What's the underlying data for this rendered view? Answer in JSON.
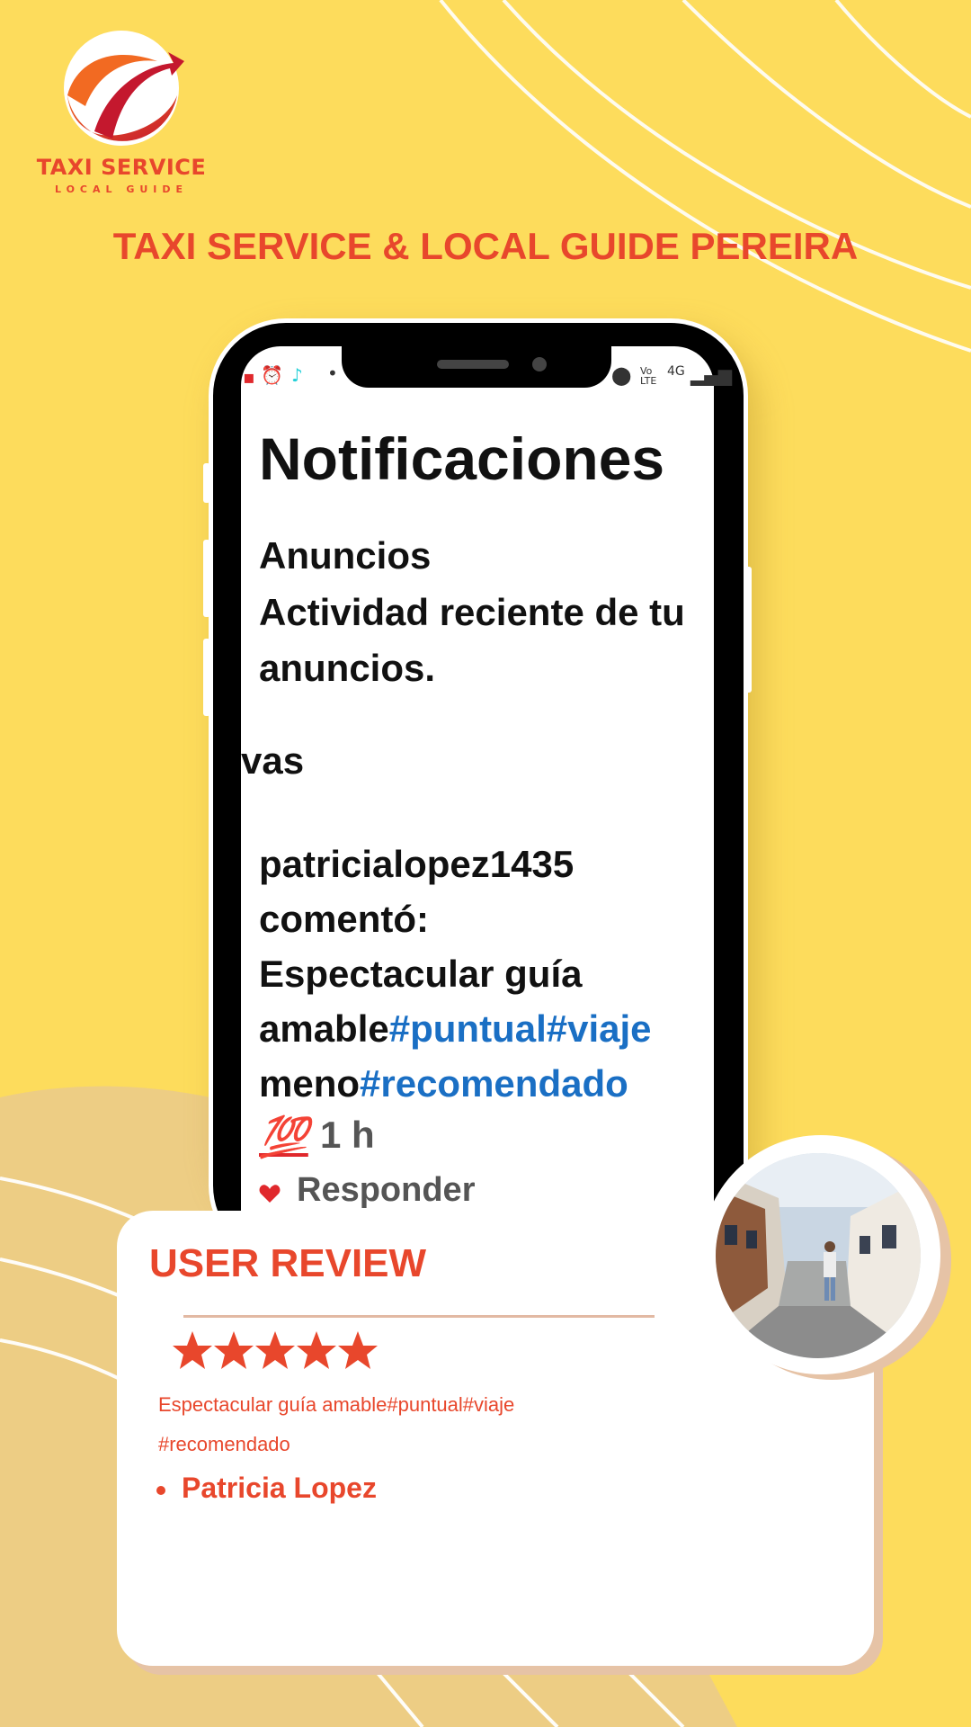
{
  "logo": {
    "title": "TAXI SERVICE",
    "subtitle": "LOCAL GUIDE",
    "colors": {
      "orange": "#E8472C",
      "red": "#C4182E"
    }
  },
  "headline": "TAXI SERVICE & LOCAL GUIDE PEREIRA",
  "phone": {
    "status_bar": {
      "icons": [
        "notification-icon",
        "alarm-icon",
        "tiktok-icon",
        "dot-icon",
        "location-icon",
        "volte-icon",
        "signal-4g-icon",
        "signal-bars-icon"
      ],
      "volte": "Vo LTE",
      "network": "4G"
    },
    "screen": {
      "title": "Notificaciones",
      "section": "Anuncios",
      "section_desc_line1": "Actividad reciente de tu",
      "section_desc_line2": "anuncios.",
      "partial_label": "vas",
      "username": "patricialopez1435",
      "action": "comentó:",
      "comment_line1": "Espectacular guía",
      "comment_line2_plain": "amable",
      "comment_line2_tags": "#puntual#viaje",
      "comment_line3_plain": "meno",
      "comment_line3_tags": "#recomendado",
      "emoji": "💯",
      "time": "1 h",
      "reply": "Responder"
    }
  },
  "review": {
    "title": "USER REVIEW",
    "rating": 5,
    "rating_max": 5,
    "text_line1": "Espectacular guía amable#puntual#viaje",
    "text_line2": "#recomendado",
    "reviewer": "Patricia Lopez"
  },
  "colors": {
    "background": "#FDDC5C",
    "accent": "#E8472C",
    "hashtag_blue": "#1A6FC4"
  }
}
